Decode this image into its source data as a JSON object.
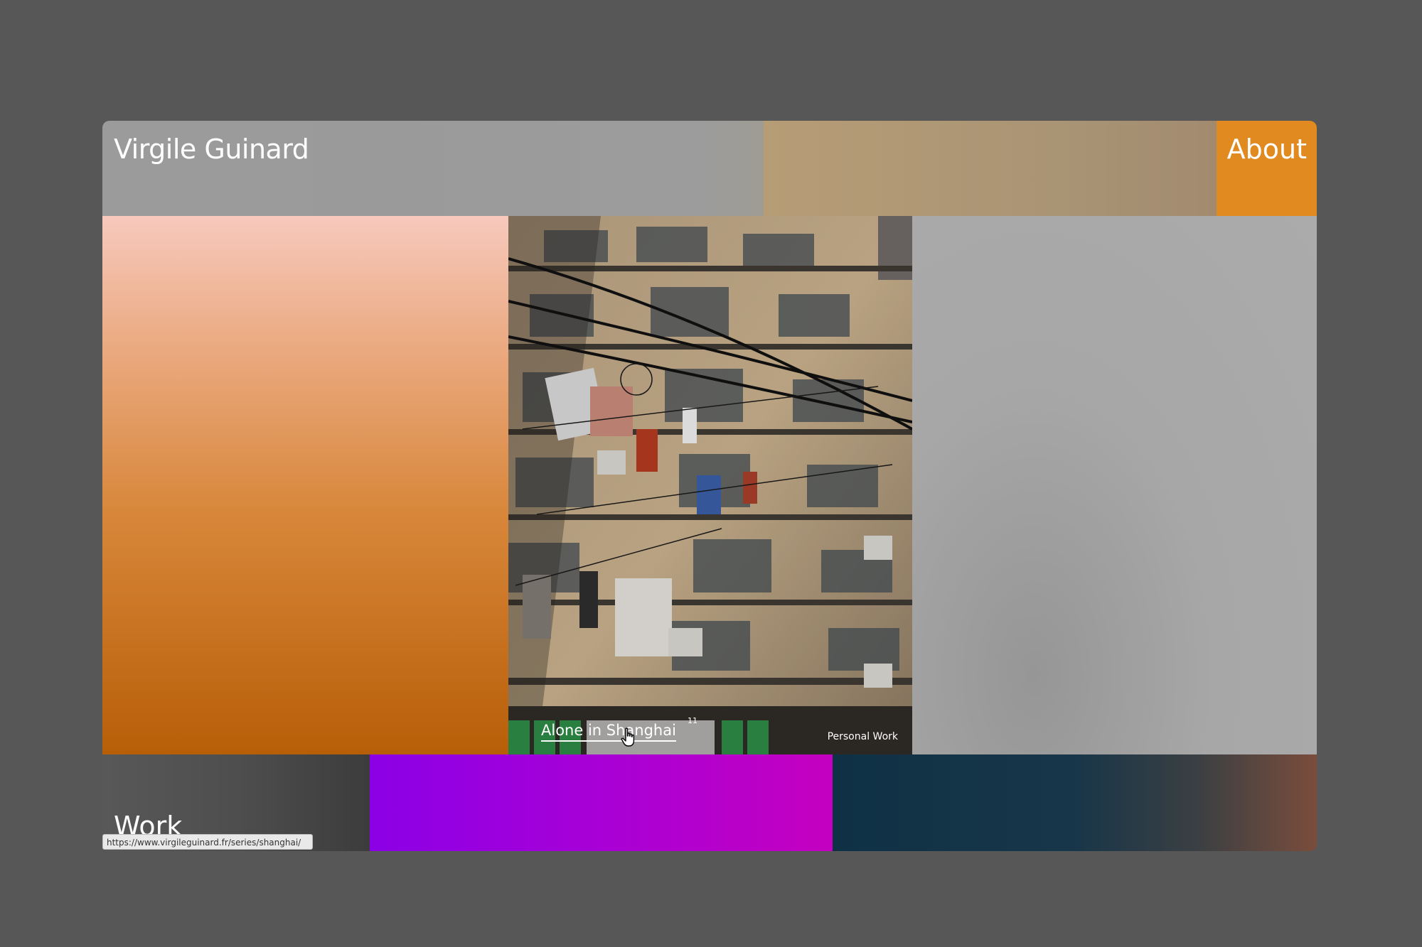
{
  "header": {
    "site_title": "Virgile Guinard",
    "about_label": "About"
  },
  "featured": {
    "title": "Alone in Shanghai",
    "count": "11",
    "category": "Personal Work"
  },
  "footer": {
    "work_label": "Work"
  },
  "status_bar": {
    "url": "https://www.virgileguinard.fr/series/shanghai/"
  },
  "icons": {
    "cursor": "hand-pointer-icon"
  },
  "colors": {
    "background": "#575757",
    "about_tile": "#e08a20",
    "purple_tile": "#a800d6",
    "teal_tile": "#0f3145"
  }
}
